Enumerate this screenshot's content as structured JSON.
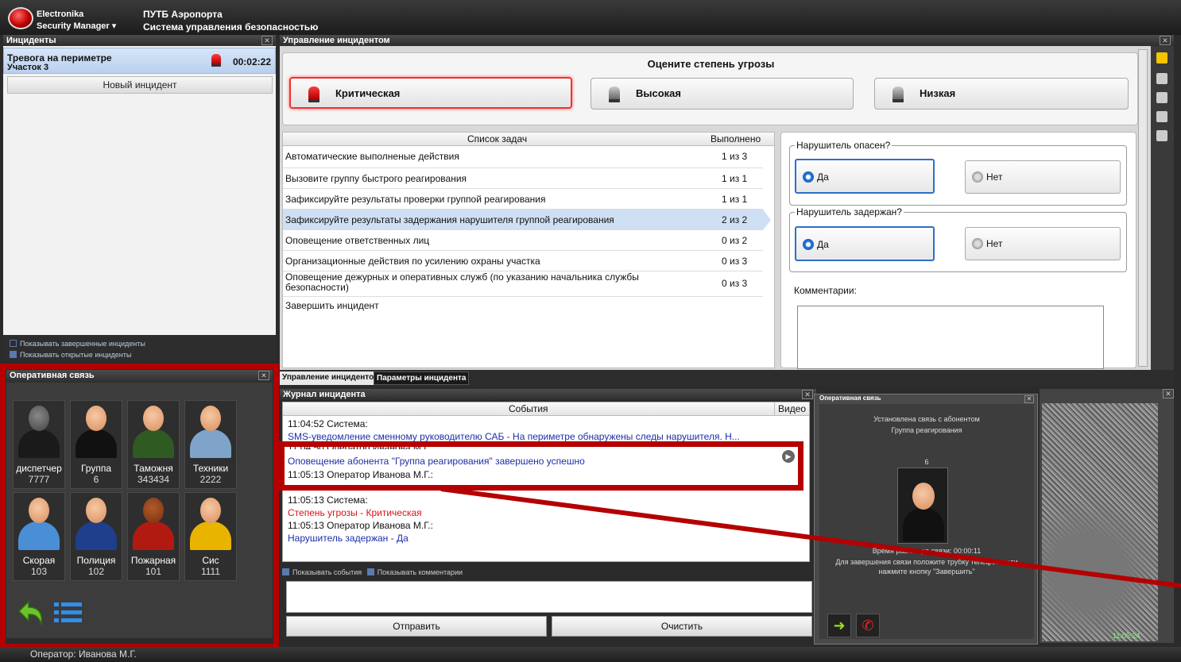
{
  "titlebar": {
    "app_name": "Electronika",
    "app_sub": "Security Manager ▾",
    "sys_title": "ПУТБ Аэропорта",
    "sys_subtitle": "Система управления безопасностью"
  },
  "incidents": {
    "header": "Инциденты",
    "item_title": "Тревога на периметре",
    "item_sub": "Участок 3",
    "item_time": "00:02:22",
    "new_button": "Новый инцидент",
    "show_finished": "Показывать завершенные инциденты",
    "show_open": "Показывать открытые инциденты"
  },
  "op": {
    "header": "Оперативная связь",
    "contacts": [
      {
        "name": "диспетчер",
        "num": "7777"
      },
      {
        "name": "Группа",
        "num": "6"
      },
      {
        "name": "Таможня",
        "num": "343434"
      },
      {
        "name": "Техники",
        "num": "2222"
      },
      {
        "name": "Скорая",
        "num": "103"
      },
      {
        "name": "Полиция",
        "num": "102"
      },
      {
        "name": "Пожарная",
        "num": "101"
      },
      {
        "name": "Сис",
        "num": "1111"
      }
    ]
  },
  "mgmt": {
    "header": "Управление инцидентом",
    "threat_title": "Оцените степень угрозы",
    "threat_critical": "Критическая",
    "threat_high": "Высокая",
    "threat_low": "Низкая",
    "col_tasks": "Список задач",
    "col_done": "Выполнено",
    "tasks": [
      {
        "text": "Автоматические выполненые действия",
        "done": "1 из 3"
      },
      {
        "text": "Вызовите группу быстрого реагирования",
        "done": "1 из 1"
      },
      {
        "text": "Зафиксируйте результаты проверки группой реагирования",
        "done": "1 из 1"
      },
      {
        "text": "Зафиксируйте результаты задержания нарушителя группой реагирования",
        "done": "2 из 2"
      },
      {
        "text": "Оповещение ответственных лиц",
        "done": "0 из 2"
      },
      {
        "text": "Организационные действия по усилению охраны участка",
        "done": "0 из 3"
      },
      {
        "text": "Оповещение дежурных и оперативных служб (по указанию начальника службы безопасности)",
        "done": "0 из 3"
      },
      {
        "text": "Завершить инцидент",
        "done": ""
      }
    ],
    "q1": "Нарушитель опасен?",
    "q2": "Нарушитель задержан?",
    "yes": "Да",
    "no": "Нет",
    "comments": "Комментарии:"
  },
  "tabs": {
    "tab1": "Управление инцидентом",
    "tab2": "Параметры инцидента"
  },
  "journal": {
    "header": "Журнал инцидента",
    "col_events": "События",
    "col_video": "Видео",
    "lines": [
      "11:04:52   Система:",
      "SMS-уведомление сменному руководителю САБ - На периметре обнаружены следы нарушителя. Н...",
      "11:04:50   Оператор Иванова М.Г.:",
      "Оповещение абонента \"Группа реагирования\" завершено успешно",
      "11:05:13   Оператор Иванова М.Г.:",
      "11:05:13   Система:",
      "Степень угрозы - Критическая",
      "11:05:13   Оператор Иванова М.Г.:",
      "Нарушитель задержан - Да"
    ],
    "show_events": "Показывать события",
    "show_comments": "Показывать комментарии",
    "send": "Отправить",
    "clear": "Очистить"
  },
  "popup": {
    "header": "Оперативная связь",
    "line1": "Установлена связь с абонентом",
    "line2": "Группа реагирования",
    "num": "6",
    "duration": "Время разговора связи: 00:00:11",
    "hint1": "Для завершения связи положите трубку телефона или",
    "hint2": "нажмите кнопку \"Завершить\""
  },
  "video": {
    "timestamp": "11:05:24"
  },
  "status": {
    "operator": "Оператор:  Иванова М.Г."
  },
  "colors": {
    "accent_red": "#b40000",
    "selection": "#cfe0f5",
    "link_blue": "#1d2fa6"
  }
}
